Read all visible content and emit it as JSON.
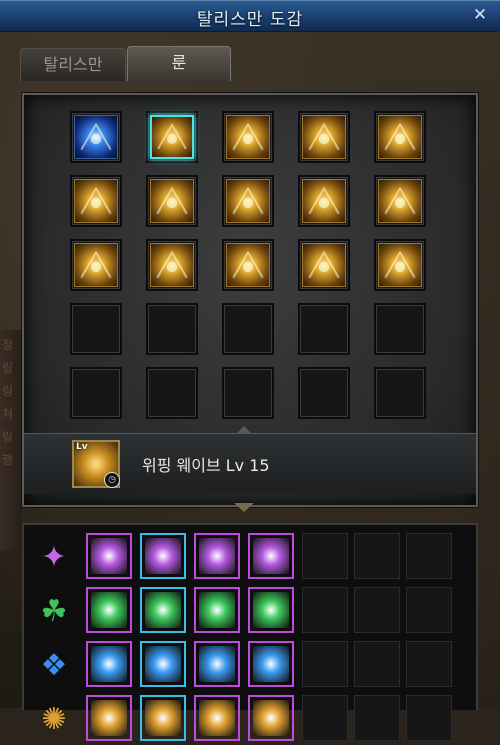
{
  "window": {
    "title": "탈리스만 도감",
    "close_glyph": "✕"
  },
  "tabs": [
    {
      "label": "탈리스만",
      "active": false
    },
    {
      "label": "룬",
      "active": true
    }
  ],
  "rune_grid": {
    "rows": [
      [
        "blue-star-rune",
        "gold-crown-rune-selected",
        "gold-swirl-rune",
        "gold-dash-rune",
        "gold-flame-rune"
      ],
      [
        "gold-burst-rune",
        "gold-wave-rune",
        "gold-radiance-rune",
        "gold-bars-rune",
        "gold-pillar-rune"
      ],
      [
        "gold-spark-rune",
        "gold-comet-rune",
        "gold-fountain-rune",
        "gold-vortex-rune",
        "gold-blaze-rune"
      ],
      [
        "empty",
        "empty",
        "empty",
        "empty",
        "empty"
      ],
      [
        "empty",
        "empty",
        "empty",
        "empty",
        "empty"
      ]
    ],
    "selected_index": 1
  },
  "selected_rune": {
    "name": "위핑 웨이브 Lv 15",
    "icon_badge": "Lv",
    "icon_clock": "◷"
  },
  "lower_rows": [
    {
      "emblem": "✦",
      "emblem_color": "#c06ae8",
      "gem_color": "#b45ae0"
    },
    {
      "emblem": "☘",
      "emblem_color": "#3ec45a",
      "gem_color": "#3cc85a"
    },
    {
      "emblem": "❖",
      "emblem_color": "#3a8ef0",
      "gem_color": "#3a9af0"
    },
    {
      "emblem": "✺",
      "emblem_color": "#e0a030",
      "gem_color": "#e0a030"
    }
  ],
  "bg_side_text": [
    "정",
    "링",
    "링",
    "쳐",
    "링",
    "행"
  ]
}
